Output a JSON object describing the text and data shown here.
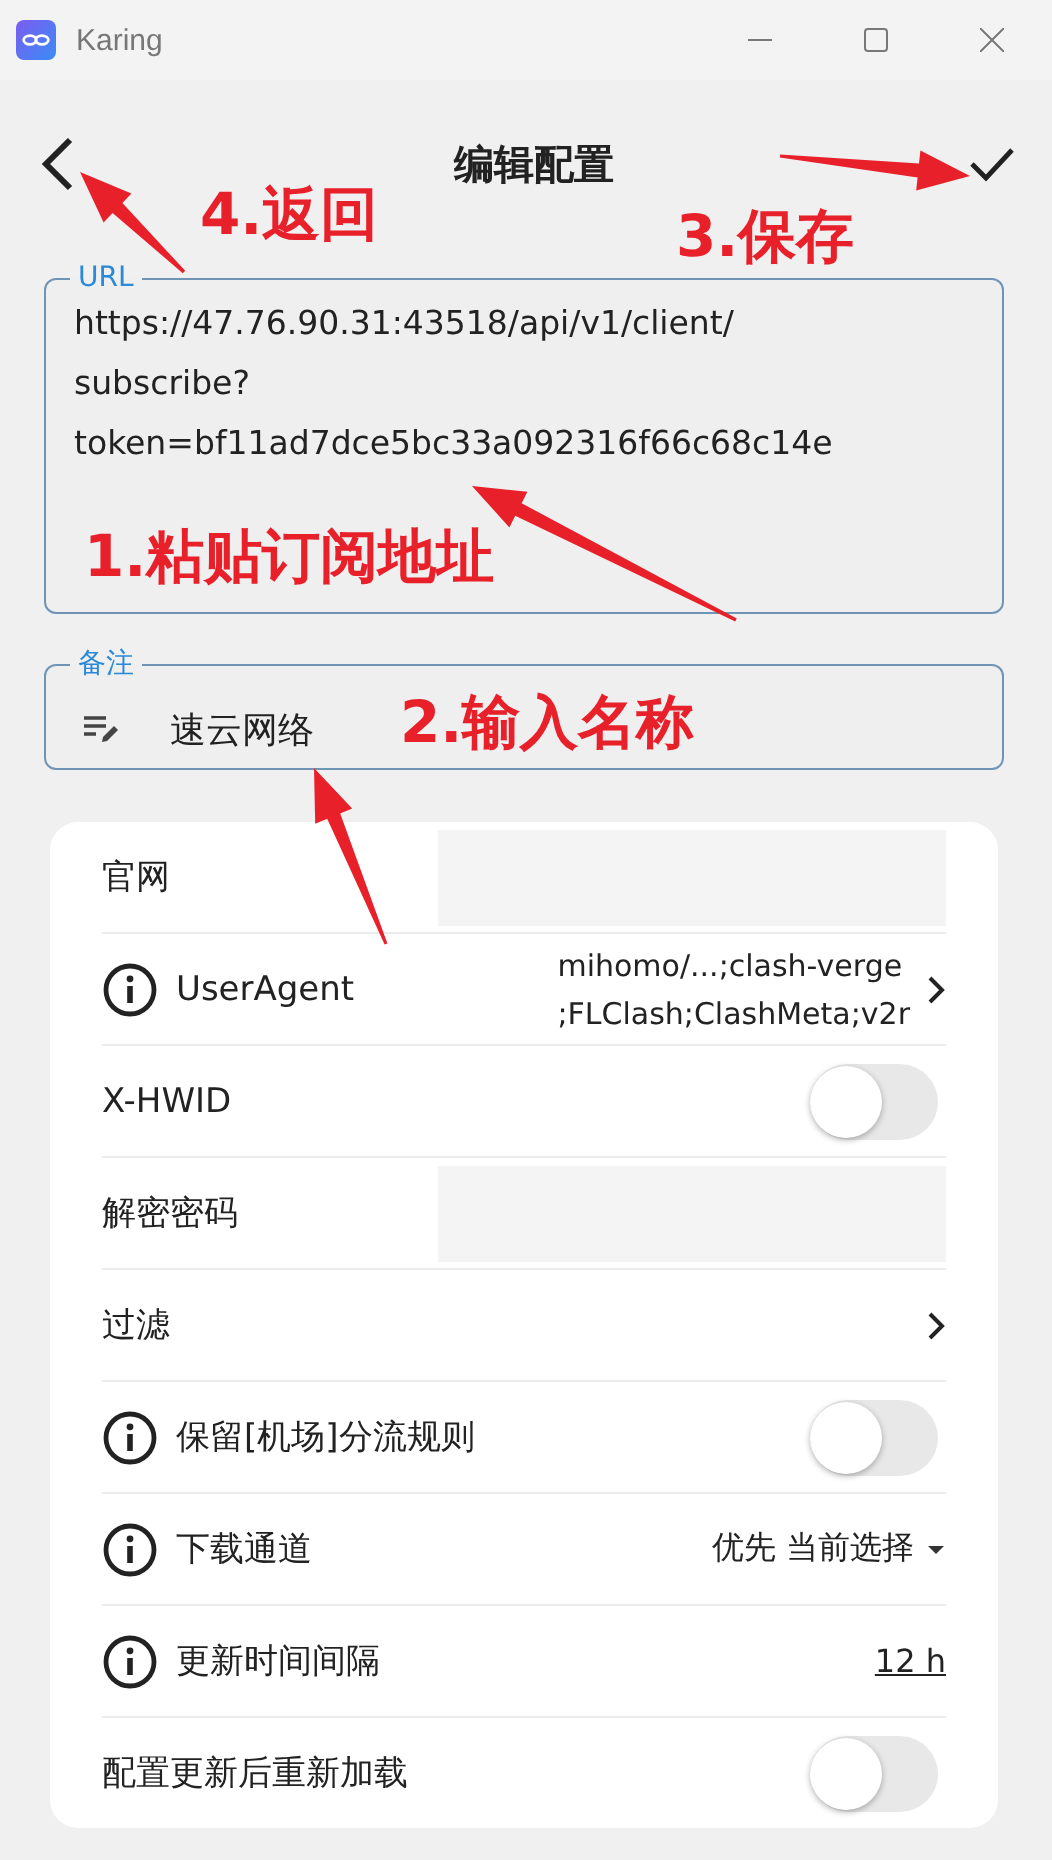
{
  "window": {
    "title": "Karing"
  },
  "header": {
    "title": "编辑配置"
  },
  "url_field": {
    "label": "URL",
    "value_lines": [
      "https://47.76.90.31:43518/api/v1/client/",
      "subscribe?",
      "token=bf11ad7dce5bc33a092316f66c68c14e"
    ]
  },
  "remark_field": {
    "label": "备注",
    "value": "速云网络"
  },
  "settings": [
    {
      "kind": "field",
      "label": "官网",
      "info": false
    },
    {
      "kind": "value",
      "label": "UserAgent",
      "info": true,
      "value_lines": [
        "mihomo/...;clash-verge",
        ";FLClash;ClashMeta;v2r"
      ]
    },
    {
      "kind": "toggle",
      "label": "X-HWID",
      "info": false,
      "on": false
    },
    {
      "kind": "field",
      "label": "解密密码",
      "info": false
    },
    {
      "kind": "chevron",
      "label": "过滤",
      "info": false
    },
    {
      "kind": "toggle",
      "label": "保留[机场]分流规则",
      "info": true,
      "on": false
    },
    {
      "kind": "dropdown",
      "label": "下载通道",
      "info": true,
      "value": "优先 当前选择"
    },
    {
      "kind": "link",
      "label": "更新时间间隔",
      "info": true,
      "value": "12 h"
    },
    {
      "kind": "toggle",
      "label": "配置更新后重新加载",
      "info": false,
      "on": false
    }
  ],
  "annotations": [
    {
      "text": "4.返回"
    },
    {
      "text": "3.保存"
    },
    {
      "text": "1.粘贴订阅地址"
    },
    {
      "text": "2.输入名称"
    }
  ]
}
